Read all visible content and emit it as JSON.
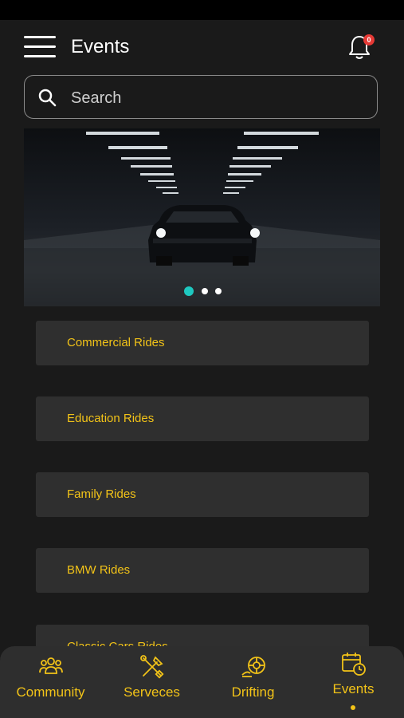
{
  "header": {
    "title": "Events",
    "notification_count": "0"
  },
  "search": {
    "placeholder": "Search"
  },
  "carousel": {
    "active_index": 0,
    "total": 3
  },
  "rides": [
    {
      "label": "Commercial Rides"
    },
    {
      "label": "Education Rides"
    },
    {
      "label": "Family Rides"
    },
    {
      "label": "BMW Rides"
    },
    {
      "label": "Classic Cars Rides"
    }
  ],
  "nav": {
    "items": [
      {
        "label": "Community",
        "icon": "community-icon"
      },
      {
        "label": "Serveces",
        "icon": "tools-icon"
      },
      {
        "label": "Drifting",
        "icon": "drifting-icon"
      },
      {
        "label": "Events",
        "icon": "calendar-icon",
        "active": true
      }
    ]
  },
  "colors": {
    "accent": "#f2c318",
    "carousel_active": "#1ec8c0",
    "badge": "#e53935"
  }
}
